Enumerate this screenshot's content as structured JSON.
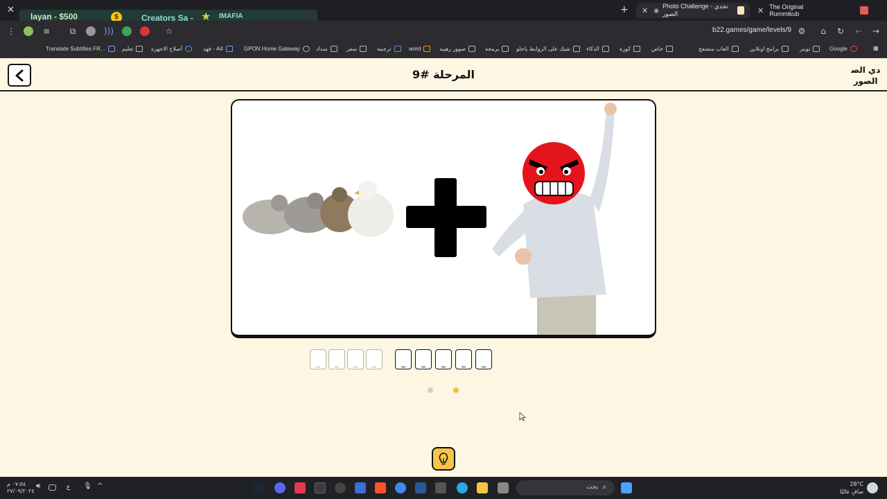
{
  "browser": {
    "tabs": [
      {
        "label": "Photo Challenge - تحدي الصور",
        "active": true
      },
      {
        "label": "The Original Rummikub",
        "active": false
      }
    ],
    "url": "b22.games/game/levels/9",
    "overlay": {
      "text1": "layan - $500",
      "text2": "Creators Sa -",
      "text3": "IMAFIA"
    },
    "bookmarks": [
      "Google",
      "تويتر",
      "برامج اونلاين",
      "العاب متصفح",
      "خاص",
      "كورة",
      "الذكاء",
      "شيك على الروابط ياحلو",
      "برمجة",
      "صوور رهيبه",
      "word",
      "ترجمة",
      "سفر",
      "سداد",
      "GPON Home Gateway",
      "فهد - A4",
      "أصلاح الاجهزه",
      "تعليم",
      "Translate Subtitles FR..."
    ]
  },
  "page": {
    "level_title": "المرحلة #9",
    "back_icon": "chevron-left-icon",
    "logo_text": "تحدي الصور",
    "puzzle": {
      "left_image": "birds (chicks)",
      "operator": "+",
      "right_image": "angry boy"
    },
    "answer": {
      "word1_slots": [
        "_",
        "_",
        "_",
        "_"
      ],
      "word2_slots": [
        "_",
        "_",
        "_",
        "_",
        "_"
      ]
    },
    "pagination_dots": 2,
    "hint_icon": "lightbulb-icon",
    "colors": {
      "background": "#fdf6e3",
      "accent": "#f6c548",
      "border": "#111111"
    }
  },
  "taskbar": {
    "search_placeholder": "بحث",
    "clock_time": "٠٧:٥٤ م",
    "clock_date": "٢٧/٠٩/٢٠٢٤",
    "lang": "ع",
    "weather_temp": "28°C",
    "weather_desc": "صافٍ غالبًا"
  }
}
